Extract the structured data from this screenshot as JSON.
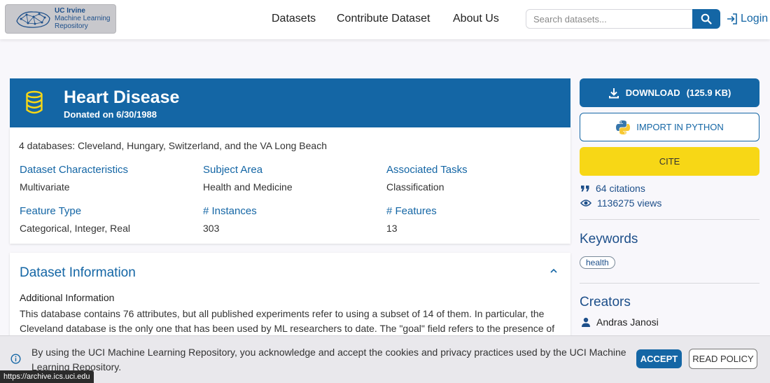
{
  "header": {
    "logo": {
      "line1": "UC Irvine",
      "line2": "Machine Learning",
      "line3": "Repository"
    },
    "nav": {
      "datasets": "Datasets",
      "contribute": "Contribute Dataset",
      "about": "About Us"
    },
    "search": {
      "placeholder": "Search datasets..."
    },
    "login": "Login"
  },
  "dataset": {
    "title": "Heart Disease",
    "donated": "Donated on 6/30/1988",
    "description": "4 databases: Cleveland, Hungary, Switzerland, and the VA Long Beach",
    "characteristics": [
      {
        "label": "Dataset Characteristics",
        "value": "Multivariate"
      },
      {
        "label": "Subject Area",
        "value": "Health and Medicine"
      },
      {
        "label": "Associated Tasks",
        "value": "Classification"
      },
      {
        "label": "Feature Type",
        "value": "Categorical, Integer, Real"
      },
      {
        "label": "# Instances",
        "value": "303"
      },
      {
        "label": "# Features",
        "value": "13"
      }
    ]
  },
  "info": {
    "title": "Dataset Information",
    "additional_label": "Additional Information",
    "additional_text": "This database contains 76 attributes, but all published experiments refer to using a subset of 14 of them.  In particular, the Cleveland database is the only one that has been used by ML researchers to date.  The \"goal\" field refers to the presence of"
  },
  "sidebar": {
    "download": {
      "label": "DOWNLOAD",
      "size": "(125.9 KB)"
    },
    "import": "IMPORT IN PYTHON",
    "cite": "CITE",
    "citations": "64 citations",
    "views": "1136275 views",
    "keywords_title": "Keywords",
    "keywords": [
      "health"
    ],
    "creators_title": "Creators",
    "creators": [
      "Andras Janosi"
    ]
  },
  "cookie": {
    "text": "By using the UCI Machine Learning Repository, you acknowledge and accept the cookies and privacy practices used by the UCI Machine Learning Repository.",
    "accept": "ACCEPT",
    "policy": "READ POLICY"
  },
  "status_url": "https://archive.ics.uci.edu",
  "colors": {
    "primary": "#1466a5",
    "cite": "#f7d716",
    "heading": "#1d4f8a"
  }
}
